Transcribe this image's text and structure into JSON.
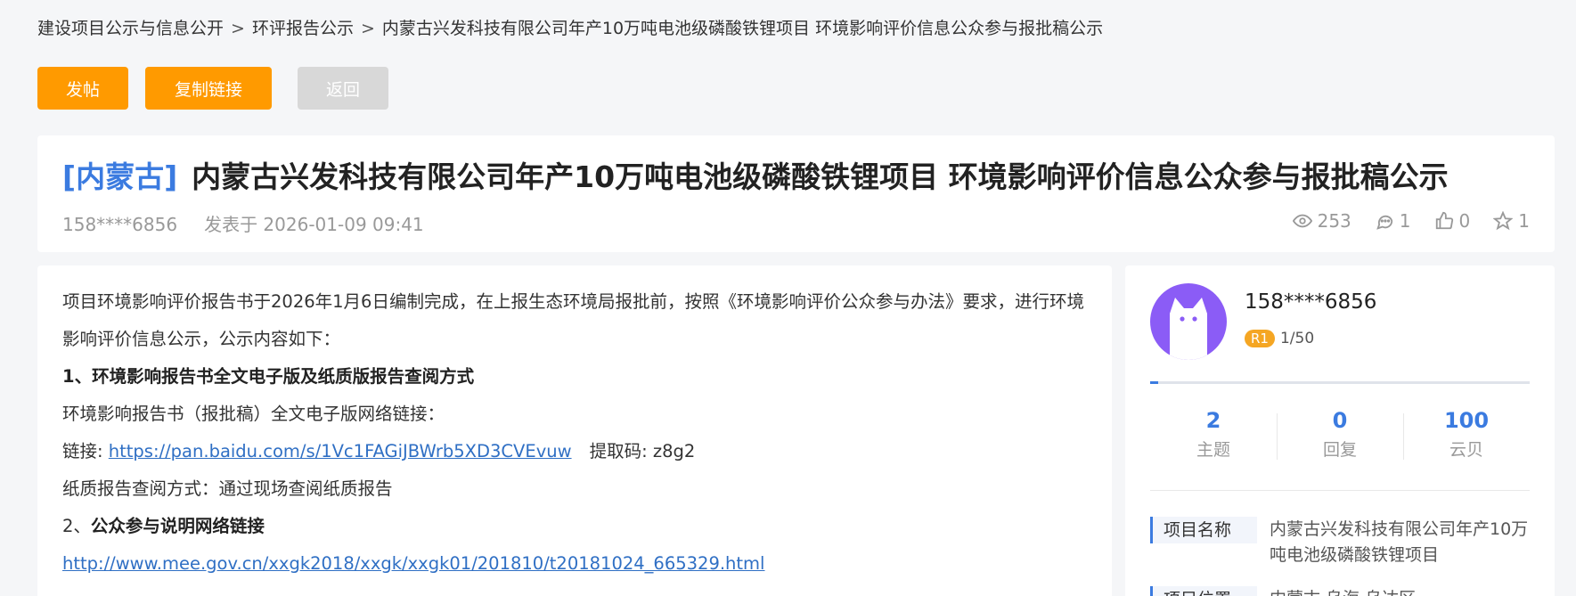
{
  "breadcrumb": {
    "items": [
      "建设项目公示与信息公开",
      "环评报告公示",
      "内蒙古兴发科技有限公司年产10万吨电池级磷酸铁锂项目 环境影响评价信息公众参与报批稿公示"
    ],
    "separator": ">"
  },
  "toolbar": {
    "post_label": "发帖",
    "copy_link_label": "复制链接",
    "back_label": "返回"
  },
  "post": {
    "region": "[内蒙古]",
    "title": "内蒙古兴发科技有限公司年产10万吨电池级磷酸铁锂项目 环境影响评价信息公众参与报批稿公示",
    "author": "158****6856",
    "published": "发表于 2026-01-09 09:41",
    "views": "253",
    "comments": "1",
    "likes": "0",
    "favorites": "1"
  },
  "content": {
    "intro": "项目环境影响评价报告书于2026年1月6日编制完成，在上报生态环境局报批前，按照《环境影响评价公众参与办法》要求，进行环境影响评价信息公示，公示内容如下：",
    "section1_title": "1、环境影响报告书全文电子版及纸质版报告查阅方式",
    "ebook_label": "环境影响报告书（报批稿）全文电子版网络链接：",
    "link_prefix": "链接:",
    "link_url": "https://pan.baidu.com/s/1Vc1FAGiJBWrb5XD3CVEvuw",
    "code_text": "提取码: z8g2",
    "paper_text": "纸质报告查阅方式：通过现场查阅纸质报告",
    "section2_num": "2、",
    "section2_title": "公众参与说明网络链接",
    "link2_url": "http://www.mee.gov.cn/xxgk2018/xxgk/xxgk01/201810/t20181024_665329.html"
  },
  "profile": {
    "name": "158****6856",
    "rank_badge": "R1",
    "rank_progress": "1/50",
    "progress_fraction": 0.02,
    "stats": [
      {
        "num": "2",
        "label": "主题"
      },
      {
        "num": "0",
        "label": "回复"
      },
      {
        "num": "100",
        "label": "云贝"
      }
    ],
    "info": [
      {
        "key": "项目名称",
        "value": "内蒙古兴发科技有限公司年产10万吨电池级磷酸铁锂项目"
      },
      {
        "key": "项目位置",
        "value": "内蒙古 乌海 乌达区"
      }
    ]
  },
  "colors": {
    "accent_orange": "#ff9a00",
    "accent_blue": "#3b7be0",
    "avatar_purple": "#8b5cf6"
  }
}
